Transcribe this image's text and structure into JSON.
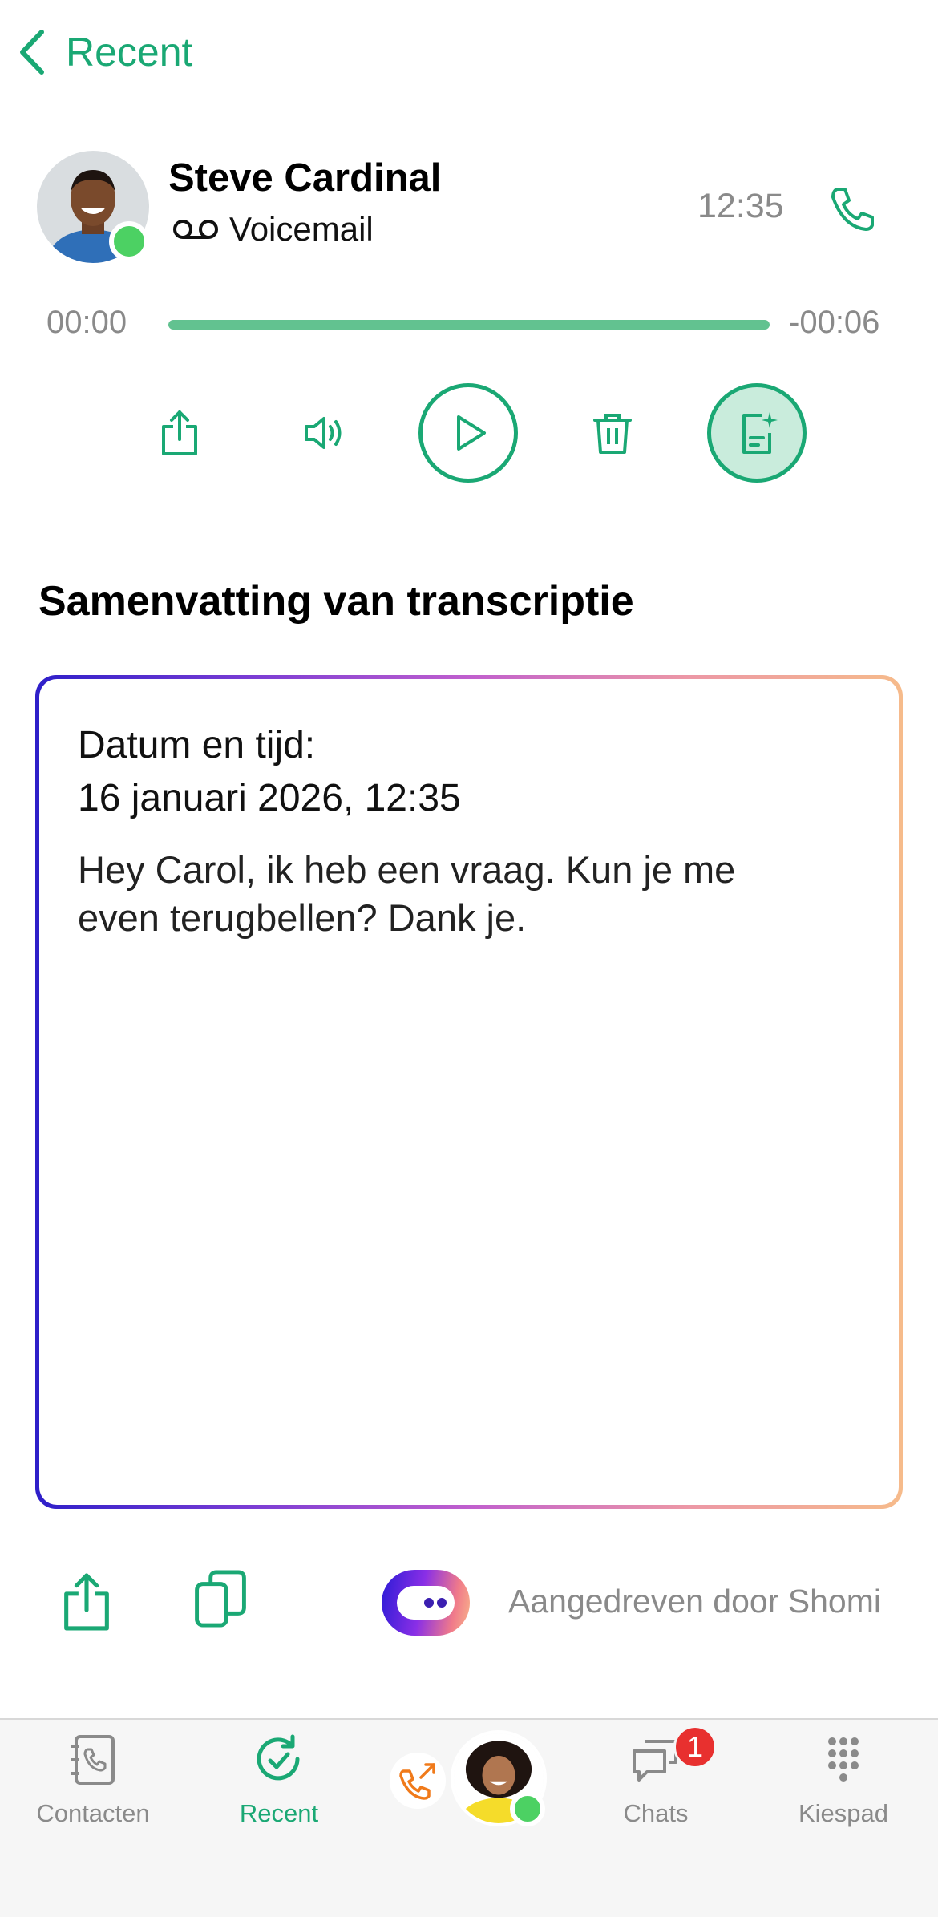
{
  "header": {
    "back_label": "Recent"
  },
  "contact": {
    "name": "Steve Cardinal",
    "type_label": "Voicemail",
    "time": "12:35",
    "status": "online"
  },
  "player": {
    "elapsed": "00:00",
    "remaining": "-00:06",
    "progress": 1.0
  },
  "controls": [
    "share-icon",
    "speaker-icon",
    "play-icon",
    "trash-icon",
    "ai-summary-icon"
  ],
  "summary": {
    "heading": "Samenvatting van transcriptie",
    "date_label": "Datum en tijd:",
    "date_value": "16 januari 2026, 12:35",
    "text": "Hey Carol, ik heb een vraag. Kun je me even terugbellen? Dank je."
  },
  "footer": {
    "powered_by": "Aangedreven door Shomi"
  },
  "tabs": [
    {
      "label": "Contacten",
      "icon": "contacts-icon",
      "active": false
    },
    {
      "label": "Recent",
      "icon": "recent-icon",
      "active": true
    },
    {
      "label": "Chats",
      "icon": "chats-icon",
      "active": false,
      "badge": "1"
    },
    {
      "label": "Kiespad",
      "icon": "keypad-icon",
      "active": false
    }
  ],
  "colors": {
    "accent": "#1aa874",
    "status_online": "#4cd163",
    "badge": "#e8302f"
  }
}
